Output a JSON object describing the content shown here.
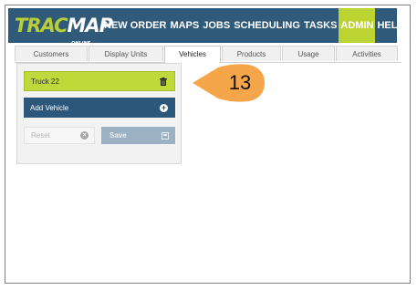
{
  "header": {
    "logo_main": "TRAC",
    "logo_accent": "MAP",
    "logo_sub": "ONLINE",
    "nav": [
      "NEW ORDER",
      "MAPS",
      "JOBS",
      "SCHEDULING",
      "TASKS",
      "ADMIN",
      "HELP"
    ],
    "active_nav": "ADMIN"
  },
  "tabs": [
    {
      "label": "Customers"
    },
    {
      "label": "Display Units"
    },
    {
      "label": "Vehicles",
      "active": true
    },
    {
      "label": "Products"
    },
    {
      "label": "Usage"
    },
    {
      "label": "Activities"
    }
  ],
  "panel": {
    "selected_vehicle": "Truck 22",
    "add_label": "Add Vehicle",
    "reset_label": "Reset",
    "save_label": "Save"
  },
  "callout": {
    "number": "13"
  },
  "colors": {
    "nav_bg": "#2f5a7a",
    "accent_green": "#bcd431",
    "callout_orange": "#f5a54a"
  },
  "icons": [
    "trash-icon",
    "plus-circle-icon",
    "x-circle-icon",
    "floppy-disk-icon"
  ]
}
